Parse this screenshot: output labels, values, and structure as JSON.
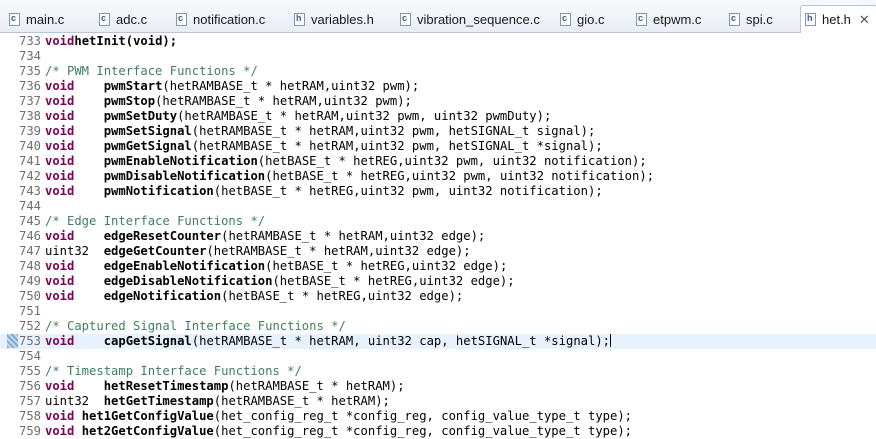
{
  "tabs": [
    {
      "label": "main.c",
      "icon": "c-file-icon",
      "badge": "c"
    },
    {
      "label": "adc.c",
      "icon": "c-file-icon",
      "badge": "c"
    },
    {
      "label": "notification.c",
      "icon": "c-file-icon",
      "badge": "c"
    },
    {
      "label": "variables.h",
      "icon": "h-file-icon",
      "badge": "h"
    },
    {
      "label": "vibration_sequence.c",
      "icon": "c-file-icon",
      "badge": "c"
    },
    {
      "label": "gio.c",
      "icon": "c-file-icon",
      "badge": "c"
    },
    {
      "label": "etpwm.c",
      "icon": "c-file-icon",
      "badge": "c"
    },
    {
      "label": "spi.c",
      "icon": "c-file-icon",
      "badge": "c"
    },
    {
      "label": "het.h",
      "icon": "h-file-icon",
      "badge": "h",
      "active": true,
      "close": "✕"
    }
  ],
  "lines": [
    {
      "n": "733",
      "t": "void",
      "f": "hetInit",
      "r": "(void);",
      "bold_all": true
    },
    {
      "n": "734",
      "c": ""
    },
    {
      "n": "735",
      "c": "/* PWM Interface Functions */"
    },
    {
      "n": "736",
      "t": "void    ",
      "f": "pwmStart",
      "r": "(hetRAMBASE_t * hetRAM,uint32 pwm);"
    },
    {
      "n": "737",
      "t": "void    ",
      "f": "pwmStop",
      "r": "(hetRAMBASE_t * hetRAM,uint32 pwm);"
    },
    {
      "n": "738",
      "t": "void    ",
      "f": "pwmSetDuty",
      "r": "(hetRAMBASE_t * hetRAM,uint32 pwm, uint32 pwmDuty);"
    },
    {
      "n": "739",
      "t": "void    ",
      "f": "pwmSetSignal",
      "r": "(hetRAMBASE_t * hetRAM,uint32 pwm, hetSIGNAL_t signal);"
    },
    {
      "n": "740",
      "t": "void    ",
      "f": "pwmGetSignal",
      "r": "(hetRAMBASE_t * hetRAM,uint32 pwm, hetSIGNAL_t *signal);"
    },
    {
      "n": "741",
      "t": "void    ",
      "f": "pwmEnableNotification",
      "r": "(hetBASE_t * hetREG,uint32 pwm, uint32 notification);"
    },
    {
      "n": "742",
      "t": "void    ",
      "f": "pwmDisableNotification",
      "r": "(hetBASE_t * hetREG,uint32 pwm, uint32 notification);"
    },
    {
      "n": "743",
      "t": "void    ",
      "f": "pwmNotification",
      "r": "(hetBASE_t * hetREG,uint32 pwm, uint32 notification);"
    },
    {
      "n": "744",
      "c": ""
    },
    {
      "n": "745",
      "c": "/* Edge Interface Functions */"
    },
    {
      "n": "746",
      "t": "void    ",
      "f": "edgeResetCounter",
      "r": "(hetRAMBASE_t * hetRAM,uint32 edge);"
    },
    {
      "n": "747",
      "t": "uint32  ",
      "f": "edgeGetCounter",
      "r": "(hetRAMBASE_t * hetRAM,uint32 edge);",
      "plain_type": true
    },
    {
      "n": "748",
      "t": "void    ",
      "f": "edgeEnableNotification",
      "r": "(hetBASE_t * hetREG,uint32 edge);"
    },
    {
      "n": "749",
      "t": "void    ",
      "f": "edgeDisableNotification",
      "r": "(hetBASE_t * hetREG,uint32 edge);"
    },
    {
      "n": "750",
      "t": "void    ",
      "f": "edgeNotification",
      "r": "(hetBASE_t * hetREG,uint32 edge);"
    },
    {
      "n": "751",
      "c": ""
    },
    {
      "n": "752",
      "c": "/* Captured Signal Interface Functions */"
    },
    {
      "n": "753",
      "t": "void    ",
      "f": "capGetSignal",
      "r": "(hetRAMBASE_t * hetRAM, uint32 cap, hetSIGNAL_t *signal);",
      "current": true
    },
    {
      "n": "754",
      "c": ""
    },
    {
      "n": "755",
      "c": "/* Timestamp Interface Functions */"
    },
    {
      "n": "756",
      "t": "void    ",
      "f": "hetResetTimestamp",
      "r": "(hetRAMBASE_t * hetRAM);"
    },
    {
      "n": "757",
      "t": "uint32  ",
      "f": "hetGetTimestamp",
      "r": "(hetRAMBASE_t * hetRAM);",
      "plain_type": true
    },
    {
      "n": "758",
      "t": "void ",
      "f": "het1GetConfigValue",
      "r": "(het_config_reg_t *config_reg, config_value_type_t type);"
    },
    {
      "n": "759",
      "t": "void ",
      "f": "het2GetConfigValue",
      "r": "(het_config_reg_t *config_reg, config_value_type_t type);"
    }
  ],
  "colors": {
    "keyword": "#7f0055",
    "comment": "#3f7f5f",
    "current_line": "#e8f2fe"
  }
}
